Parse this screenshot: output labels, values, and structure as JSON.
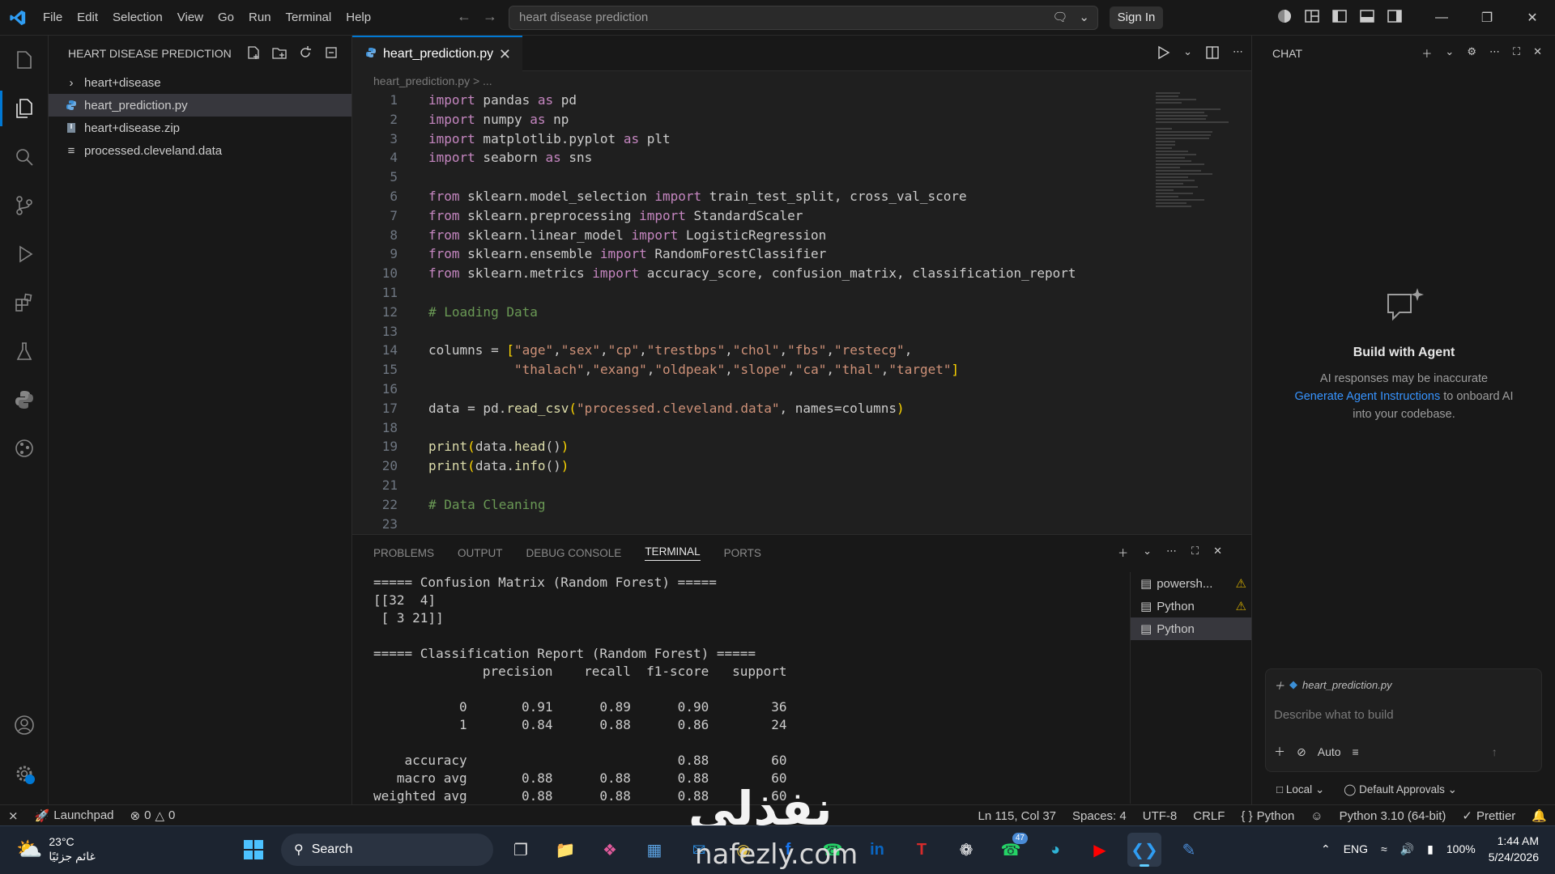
{
  "titlebar": {
    "menu": [
      "File",
      "Edit",
      "Selection",
      "View",
      "Go",
      "Run",
      "Terminal",
      "Help"
    ],
    "search": "heart disease prediction",
    "sign_in": "Sign In"
  },
  "sidebar": {
    "title": "HEART DISEASE PREDICTION",
    "items": [
      {
        "label": "heart+disease",
        "type": "folder"
      },
      {
        "label": "heart_prediction.py",
        "type": "python"
      },
      {
        "label": "heart+disease.zip",
        "type": "zip"
      },
      {
        "label": "processed.cleveland.data",
        "type": "data"
      }
    ]
  },
  "editor": {
    "tab": "heart_prediction.py",
    "breadcrumb": "heart_prediction.py > ...",
    "line_numbers": [
      "1",
      "2",
      "3",
      "4",
      "5",
      "6",
      "7",
      "8",
      "9",
      "10",
      "11",
      "12",
      "13",
      "14",
      "15",
      "16",
      "17",
      "18",
      "19",
      "20",
      "21",
      "22",
      "23"
    ]
  },
  "panel": {
    "tabs": [
      "PROBLEMS",
      "OUTPUT",
      "DEBUG CONSOLE",
      "TERMINAL",
      "PORTS"
    ],
    "active_tab": "TERMINAL",
    "terminal_lines": [
      "===== Confusion Matrix (Random Forest) =====",
      "[[32  4]",
      " [ 3 21]]",
      "",
      "===== Classification Report (Random Forest) =====",
      "              precision    recall  f1-score   support",
      "",
      "           0       0.91      0.89      0.90        36",
      "           1       0.84      0.88      0.86        24",
      "",
      "    accuracy                           0.88        60",
      "   macro avg       0.88      0.88      0.88        60",
      "weighted avg       0.88      0.88      0.88        60"
    ],
    "terminals": [
      {
        "label": "powersh...",
        "warn": true
      },
      {
        "label": "Python",
        "warn": true
      },
      {
        "label": "Python",
        "warn": false
      }
    ]
  },
  "chat": {
    "title": "CHAT",
    "heading": "Build with Agent",
    "desc1": "AI responses may be inaccurate",
    "link": "Generate Agent Instructions",
    "desc2": " to onboard AI",
    "desc3": "into your codebase.",
    "file_chip": "heart_prediction.py",
    "placeholder": "Describe what to build",
    "mode": "Auto",
    "location": "Local",
    "approvals": "Default Approvals"
  },
  "statusbar": {
    "launchpad": "Launchpad",
    "errors": "0",
    "warnings": "0",
    "position": "Ln 115, Col 37",
    "spaces": "Spaces: 4",
    "encoding": "UTF-8",
    "eol": "CRLF",
    "language": "Python",
    "interpreter": "Python 3.10 (64-bit)",
    "formatter": "Prettier"
  },
  "taskbar": {
    "temp": "23°C",
    "weather_desc": "غائم جزئيًا",
    "search": "Search",
    "lang": "ENG",
    "battery": "100%",
    "time": "1:44 AM",
    "date": "5/24/2026",
    "badge": "47"
  },
  "watermark": {
    "text": "نفذلي",
    "url": "nafezly.com"
  },
  "colors": {
    "accent": "#0078d4",
    "keyword": "#c586c0",
    "string": "#ce9178",
    "comment": "#6a9955",
    "link": "#3794ff"
  }
}
